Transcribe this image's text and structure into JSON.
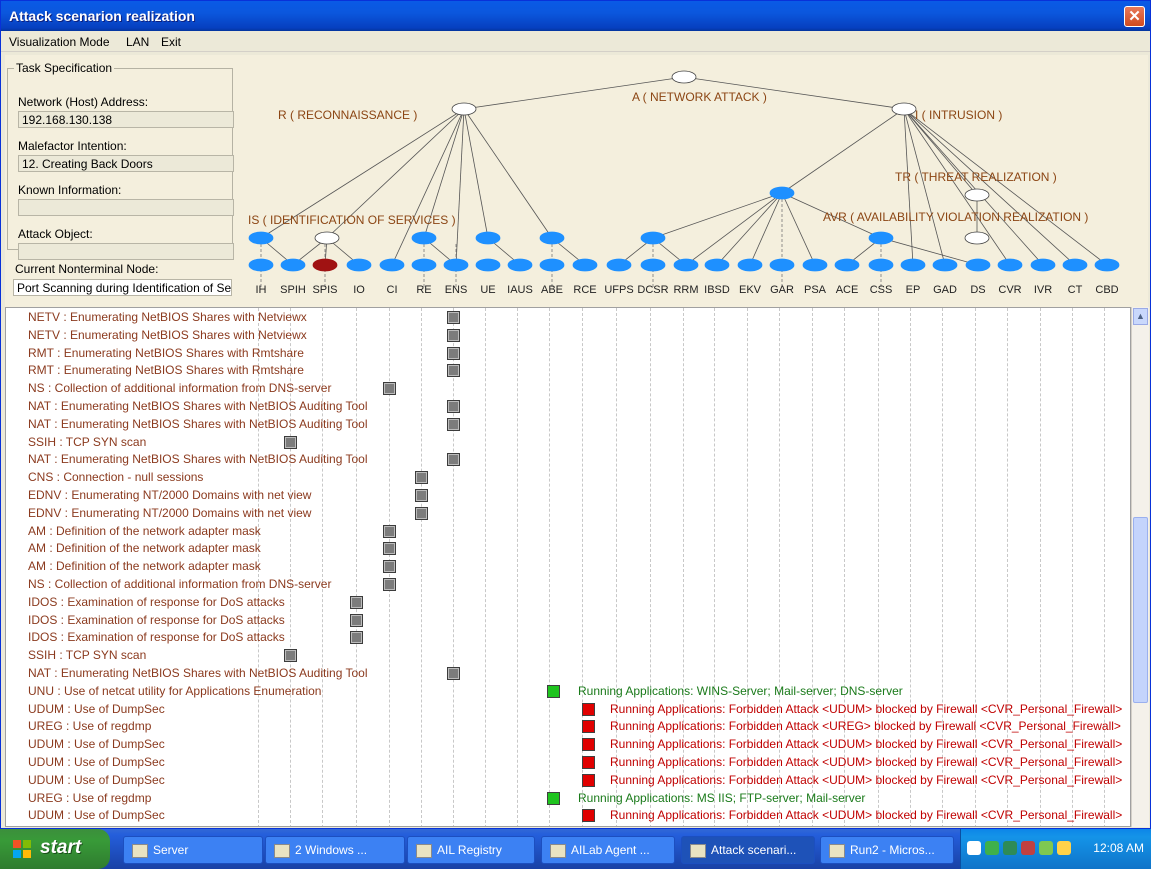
{
  "window": {
    "title": "Attack scenarion realization",
    "close_glyph": "✕"
  },
  "menu": [
    "Visualization Mode",
    "LAN",
    "Exit"
  ],
  "task": {
    "legend": "Task Specification",
    "network_label": "Network (Host) Address:",
    "network_value": "192.168.130.138",
    "intention_label": "Malefactor Intention:",
    "intention_value": "12. Creating Back Doors",
    "known_label": "Known Information:",
    "known_value": "",
    "object_label": "Attack Object:",
    "object_value": "",
    "current_label": "Current Nonterminal Node:",
    "current_value": "Port Scanning during Identification of Se"
  },
  "tree": {
    "root": "A ( NETWORK ATTACK )",
    "recon": "R ( RECONNAISSANCE )",
    "intrusion": "I ( INTRUSION )",
    "ident": "IS ( IDENTIFICATION OF SERVICES )",
    "threat": "TR ( THREAT REALIZATION )",
    "avr": "AVR ( AVAILABILITY VIOLATION REALIZATION )",
    "columns": [
      "IH",
      "SPIH",
      "SPIS",
      "IO",
      "CI",
      "RE",
      "ENS",
      "UE",
      "IAUS",
      "ABE",
      "RCE",
      "UFPS",
      "DCSR",
      "RRM",
      "IBSD",
      "EKV",
      "GAR",
      "PSA",
      "ACE",
      "CSS",
      "EP",
      "GAD",
      "DS",
      "CVR",
      "IVR",
      "CT",
      "CBD"
    ],
    "colors": {
      "node": "#1e90ff",
      "active_node": "#a01212",
      "label": "#8b4513",
      "empty_node": "#ffffff"
    }
  },
  "rows": [
    {
      "text": "NETV : Enumerating NetBIOS Shares with Netviewx",
      "col": "ENS"
    },
    {
      "text": "NETV : Enumerating NetBIOS Shares with Netviewx",
      "col": "ENS"
    },
    {
      "text": "RMT : Enumerating NetBIOS Shares with Rmtshare",
      "col": "ENS"
    },
    {
      "text": "RMT : Enumerating NetBIOS Shares with Rmtshare",
      "col": "ENS"
    },
    {
      "text": "NS : Collection of additional information from DNS-server",
      "col": "CI"
    },
    {
      "text": "NAT : Enumerating NetBIOS Shares with NetBIOS Auditing Tool",
      "col": "ENS"
    },
    {
      "text": "NAT : Enumerating NetBIOS Shares with NetBIOS Auditing Tool",
      "col": "ENS"
    },
    {
      "text": "SSIH : TCP SYN scan",
      "col": "SPIH"
    },
    {
      "text": "NAT : Enumerating NetBIOS Shares with NetBIOS Auditing Tool",
      "col": "ENS"
    },
    {
      "text": "CNS : Connection - null sessions",
      "col": "RE"
    },
    {
      "text": "EDNV : Enumerating NT/2000 Domains with net view",
      "col": "RE"
    },
    {
      "text": "EDNV : Enumerating NT/2000 Domains with net view",
      "col": "RE"
    },
    {
      "text": "AM : Definition of the network adapter mask",
      "col": "CI"
    },
    {
      "text": "AM : Definition of the network adapter mask",
      "col": "CI"
    },
    {
      "text": "AM : Definition of the network adapter mask",
      "col": "CI"
    },
    {
      "text": "NS : Collection of additional information from DNS-server",
      "col": "CI"
    },
    {
      "text": "IDOS : Examination of response for DoS attacks",
      "col": "IO"
    },
    {
      "text": "IDOS : Examination of response for DoS attacks",
      "col": "IO"
    },
    {
      "text": "IDOS : Examination of response for DoS attacks",
      "col": "IO"
    },
    {
      "text": "SSIH : TCP SYN scan",
      "col": "SPIH"
    },
    {
      "text": "NAT : Enumerating NetBIOS Shares with NetBIOS Auditing Tool",
      "col": "ENS"
    },
    {
      "text": "UNU : Use of netcat utility for Applications Enumeration",
      "status": "ok",
      "note": "Running Applications: WINS-Server; Mail-server; DNS-server"
    },
    {
      "text": "UDUM : Use of DumpSec",
      "status": "blocked",
      "note": "Running Applications: Forbidden Attack <UDUM> blocked by Firewall <CVR_Personal_Firewall>"
    },
    {
      "text": "UREG : Use of regdmp",
      "status": "blocked",
      "note": "Running Applications: Forbidden Attack <UREG> blocked by Firewall <CVR_Personal_Firewall>"
    },
    {
      "text": "UDUM : Use of DumpSec",
      "status": "blocked",
      "note": "Running Applications: Forbidden Attack <UDUM> blocked by Firewall <CVR_Personal_Firewall>"
    },
    {
      "text": "UDUM : Use of DumpSec",
      "status": "blocked",
      "note": "Running Applications: Forbidden Attack <UDUM> blocked by Firewall <CVR_Personal_Firewall>"
    },
    {
      "text": "UDUM : Use of DumpSec",
      "status": "blocked",
      "note": "Running Applications: Forbidden Attack <UDUM> blocked by Firewall <CVR_Personal_Firewall>"
    },
    {
      "text": "UREG : Use of regdmp",
      "status": "ok",
      "note": "Running Applications: MS IIS; FTP-server; Mail-server"
    },
    {
      "text": "UDUM : Use of DumpSec",
      "status": "blocked",
      "note": "Running Applications: Forbidden Attack <UDUM> blocked by Firewall <CVR_Personal_Firewall>"
    }
  ],
  "status_colors": {
    "ok": "#1fc41f",
    "blocked": "#e00000",
    "ok_text": "#1a7a1a",
    "blocked_text": "#c00000"
  },
  "taskbar": {
    "start": "start",
    "buttons": [
      "Server",
      "2 Windows ...",
      "AIL Registry",
      "AILab Agent ...",
      "Attack scenari...",
      "Run2 - Micros..."
    ],
    "clock": "12:08 AM"
  }
}
